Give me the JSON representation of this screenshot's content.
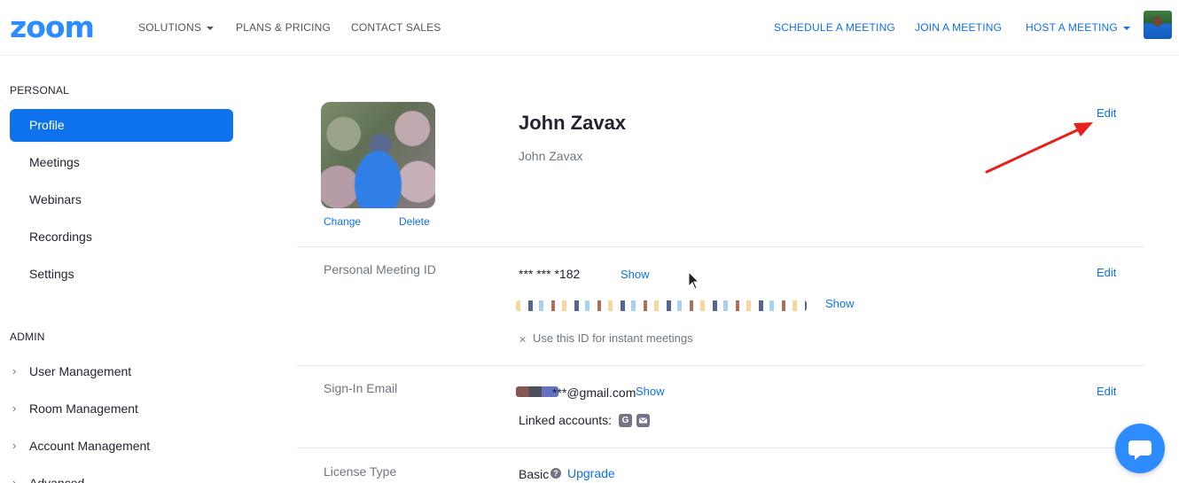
{
  "logo": "zoom",
  "nav": {
    "left": [
      "SOLUTIONS",
      "PLANS & PRICING",
      "CONTACT SALES"
    ],
    "right": [
      "SCHEDULE A MEETING",
      "JOIN A MEETING",
      "HOST A MEETING"
    ]
  },
  "sidebar": {
    "personal_header": "PERSONAL",
    "personal_items": [
      "Profile",
      "Meetings",
      "Webinars",
      "Recordings",
      "Settings"
    ],
    "active_item": "Profile",
    "admin_header": "ADMIN",
    "admin_items": [
      "User Management",
      "Room Management",
      "Account Management",
      "Advanced"
    ]
  },
  "profile": {
    "change": "Change",
    "delete": "Delete",
    "display_name": "John Zavax",
    "sub_name": "John Zavax",
    "edit": "Edit"
  },
  "pmi": {
    "label": "Personal Meeting ID",
    "masked_id": "*** *** *182",
    "show": "Show",
    "url_show": "Show",
    "instant_text": "Use this ID for instant meetings",
    "edit": "Edit"
  },
  "email": {
    "label": "Sign-In Email",
    "masked_email": "***@gmail.com",
    "show": "Show",
    "linked_label": "Linked accounts:",
    "edit": "Edit"
  },
  "license": {
    "label": "License Type",
    "value": "Basic",
    "upgrade": "Upgrade"
  },
  "colors": {
    "brand": "#2d8cff",
    "link": "#0e71eb",
    "active": "#0e72ed",
    "annotation_arrow": "#e8201b"
  }
}
